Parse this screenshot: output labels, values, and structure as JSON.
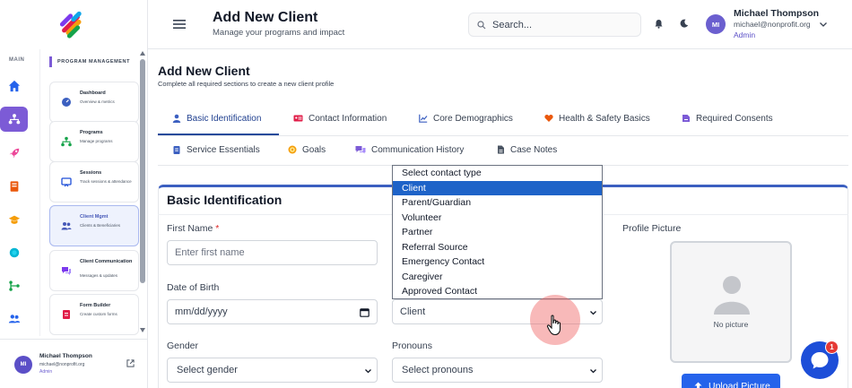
{
  "rail": {
    "label": "MAIN",
    "items": [
      {
        "icon": "home-icon",
        "color": "#2563eb"
      },
      {
        "icon": "network-icon",
        "color": "#ffffff",
        "active": true
      },
      {
        "icon": "rocket-icon",
        "color": "#ec4899"
      },
      {
        "icon": "book-icon",
        "color": "#ea580c"
      },
      {
        "icon": "graduation-cap-icon",
        "color": "#f59e0b"
      },
      {
        "icon": "globe-icon",
        "color": "#06b6d4"
      },
      {
        "icon": "sitemap-icon",
        "color": "#16a34a"
      },
      {
        "icon": "users-icon",
        "color": "#2563eb"
      }
    ]
  },
  "sidebar": {
    "section_label": "PROGRAM MANAGEMENT",
    "items": [
      {
        "title": "Dashboard",
        "subtitle": "Overview & metrics"
      },
      {
        "title": "Programs",
        "subtitle": "Manage programs"
      },
      {
        "title": "Sessions",
        "subtitle": "Track sessions & attendance"
      },
      {
        "title": "Client Mgmt",
        "subtitle": "Clients & Beneficiaries",
        "active": true
      },
      {
        "title": "Client Communication",
        "subtitle": "Messages & updates"
      },
      {
        "title": "Form Builder",
        "subtitle": "Create custom forms"
      }
    ],
    "user": {
      "initials": "MI",
      "name": "Michael Thompson",
      "email": "michael@nonprofit.org",
      "role": "Admin"
    }
  },
  "header": {
    "title": "Add New Client",
    "subtitle": "Manage your programs and impact",
    "search_placeholder": "Search...",
    "user": {
      "initials": "MI",
      "name": "Michael Thompson",
      "email": "michael@nonprofit.org",
      "role": "Admin"
    }
  },
  "page": {
    "title": "Add New Client",
    "subtitle": "Complete all required sections to create a new client profile"
  },
  "tabs": [
    {
      "label": "Basic Identification",
      "icon": "user-icon",
      "active": true
    },
    {
      "label": "Contact Information",
      "icon": "id-card-icon"
    },
    {
      "label": "Core Demographics",
      "icon": "chart-icon"
    },
    {
      "label": "Health & Safety Basics",
      "icon": "heart-icon"
    },
    {
      "label": "Required Consents",
      "icon": "signature-icon"
    },
    {
      "label": "Service Essentials",
      "icon": "clipboard-icon"
    },
    {
      "label": "Goals",
      "icon": "target-icon"
    },
    {
      "label": "Communication History",
      "icon": "comments-icon"
    },
    {
      "label": "Case Notes",
      "icon": "file-icon"
    }
  ],
  "form": {
    "section_title": "Basic Identification",
    "first_name": {
      "label": "First Name",
      "required": "*",
      "placeholder": "Enter first name"
    },
    "dob": {
      "label": "Date of Birth",
      "placeholder": "mm/dd/yyyy"
    },
    "contact_type": {
      "value": "Client"
    },
    "gender": {
      "label": "Gender",
      "value": "Select gender"
    },
    "pronouns": {
      "label": "Pronouns",
      "value": "Select pronouns"
    },
    "profile": {
      "label": "Profile Picture",
      "empty_text": "No picture",
      "upload_label": "Upload Picture"
    }
  },
  "dropdown": {
    "options": [
      "Select contact type",
      "Client",
      "Parent/Guardian",
      "Volunteer",
      "Partner",
      "Referral Source",
      "Emergency Contact",
      "Caregiver",
      "Approved Contact"
    ],
    "selected_index": 1
  },
  "chat": {
    "badge": "1"
  },
  "colors": {
    "accent": "#244a9b",
    "brand_purple": "#7c5bd6",
    "primary_button": "#2563eb",
    "required": "#dc2626"
  }
}
